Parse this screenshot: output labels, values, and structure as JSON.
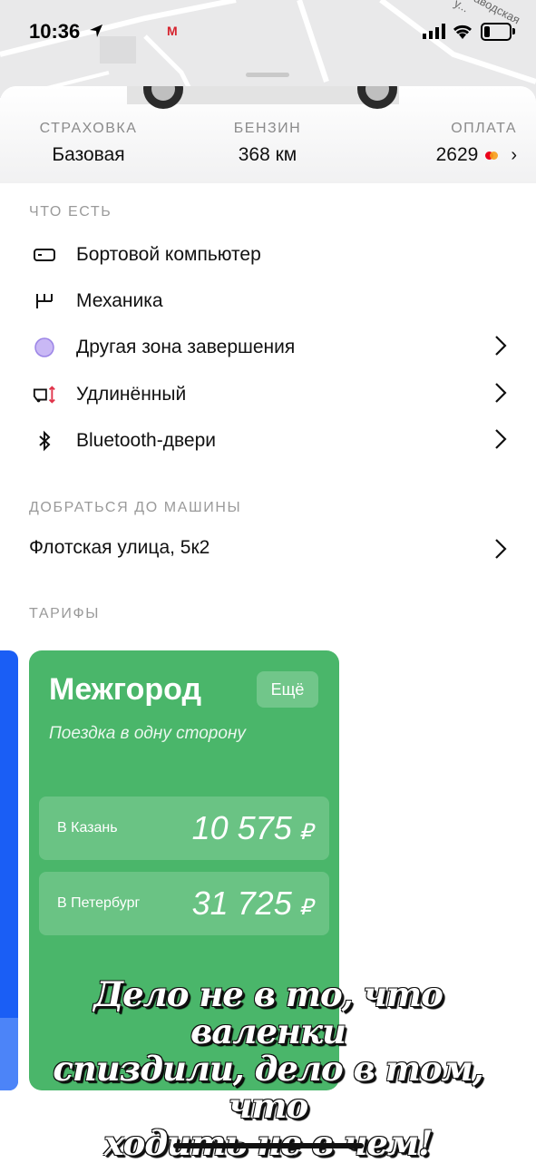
{
  "status_bar": {
    "time": "10:36",
    "map_street": "...заводская у..."
  },
  "summary": {
    "insurance": {
      "label": "СТРАХОВКА",
      "value": "Базовая"
    },
    "fuel": {
      "label": "БЕНЗИН",
      "value": "368 км"
    },
    "payment": {
      "label": "ОПЛАТА",
      "value": "2629"
    }
  },
  "features": {
    "title": "ЧТО ЕСТЬ",
    "items": [
      {
        "label": "Бортовой компьютер",
        "icon": "onboard-computer-icon",
        "has_chevron": false
      },
      {
        "label": "Механика",
        "icon": "gearbox-icon",
        "has_chevron": false
      },
      {
        "label": "Другая зона завершения",
        "icon": "zone-circle-icon",
        "has_chevron": true
      },
      {
        "label": "Удлинённый",
        "icon": "long-car-icon",
        "has_chevron": true
      },
      {
        "label": "Bluetooth-двери",
        "icon": "bluetooth-icon",
        "has_chevron": true
      }
    ]
  },
  "reach": {
    "title": "ДОБРАТЬСЯ ДО МАШИНЫ",
    "address": "Флотская улица, 5к2"
  },
  "tariffs": {
    "title": "ТАРИФЫ",
    "card": {
      "name": "Межгород",
      "more_label": "Ещё",
      "subtitle": "Поездка в одну сторону",
      "prices": [
        {
          "label": "В Казань",
          "value": "10 575",
          "currency": "₽"
        },
        {
          "label": "В Петербург",
          "value": "31 725",
          "currency": "₽"
        }
      ]
    }
  },
  "overlay": {
    "lines": [
      "Дело не в то, что валенки",
      "спиздили, дело в том, что",
      "ходить не в чем!"
    ]
  },
  "colors": {
    "card_green": "#4ab66a",
    "card_blue": "#1a5ef5",
    "zone_circle": "#c9b8f5"
  }
}
